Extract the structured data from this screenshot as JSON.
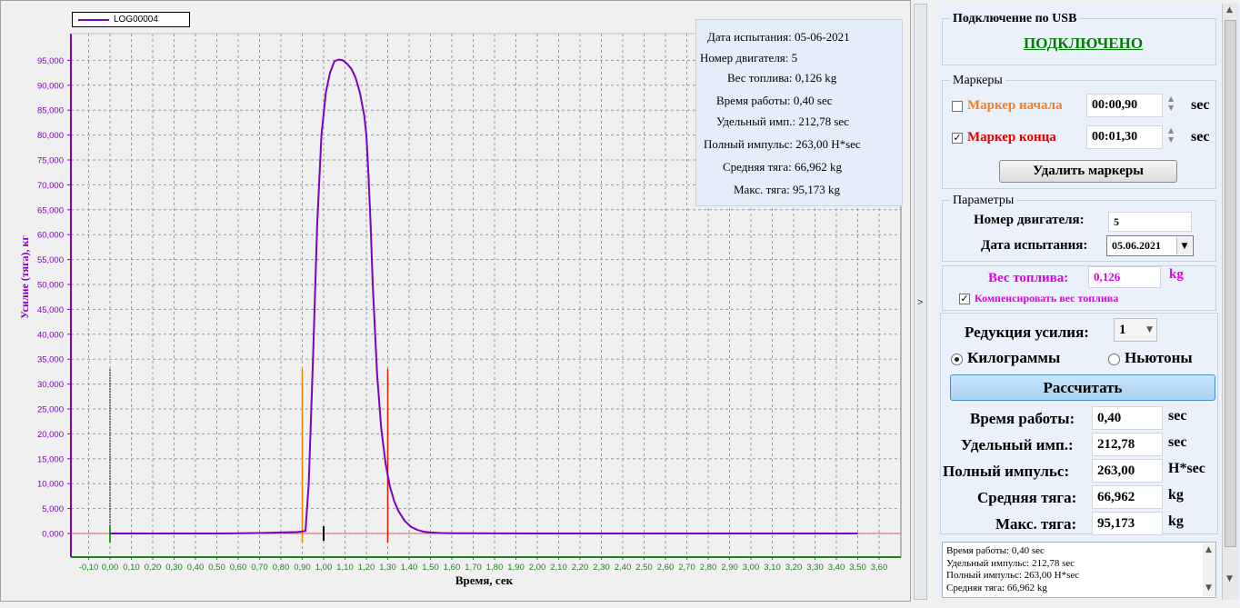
{
  "chart": {
    "legend_label": "LOG00004",
    "ylabel": "Усилие (тяга), кг",
    "xlabel": "Время, сек",
    "info": {
      "test_date": "Дата испытания: 05-06-2021",
      "engine_number": "Номер двигателя: 5",
      "fuel_weight": "Вес топлива: 0,126 kg",
      "burn_time": "Время работы: 0,40 sec",
      "specific_impulse": "Удельный имп.: 212,78 sec",
      "total_impulse": "Полный импульс: 263,00 H*sec",
      "average_thrust": "Средняя тяга: 66,962 kg",
      "max_thrust": "Макс. тяга: 95,173 kg"
    }
  },
  "chart_data": {
    "type": "line",
    "xlabel": "Время, сек",
    "ylabel": "Усилие (тяга), кг",
    "xlim": [
      -0.1,
      3.6
    ],
    "ylim": [
      0,
      100
    ],
    "xticks": [
      "-0,10",
      "0,00",
      "0,10",
      "0,20",
      "0,30",
      "0,40",
      "0,50",
      "0,60",
      "0,70",
      "0,80",
      "0,90",
      "1,00",
      "1,10",
      "1,20",
      "1,30",
      "1,40",
      "1,50",
      "1,60",
      "1,70",
      "1,80",
      "1,90",
      "2,00",
      "2,10",
      "2,20",
      "2,30",
      "2,40",
      "2,50",
      "2,60",
      "2,70",
      "2,80",
      "2,90",
      "3,00",
      "3,10",
      "3,20",
      "3,30",
      "3,40",
      "3,50",
      "3,60"
    ],
    "yticks": [
      "0,000",
      "5,000",
      "10,000",
      "15,000",
      "20,000",
      "25,000",
      "30,000",
      "35,000",
      "40,000",
      "45,000",
      "50,000",
      "55,000",
      "60,000",
      "65,000",
      "70,000",
      "75,000",
      "80,000",
      "85,000",
      "90,000",
      "95,000"
    ],
    "grid": true,
    "legend": "top-left",
    "series": [
      {
        "name": "LOG00004",
        "color": "#8000c0",
        "x": [
          0.0,
          0.5,
          0.7,
          0.8,
          0.88,
          0.915,
          0.93,
          0.95,
          0.97,
          0.99,
          1.01,
          1.03,
          1.05,
          1.07,
          1.09,
          1.11,
          1.13,
          1.15,
          1.17,
          1.19,
          1.2,
          1.21,
          1.22,
          1.23,
          1.25,
          1.27,
          1.29,
          1.31,
          1.33,
          1.35,
          1.38,
          1.41,
          1.44,
          1.47,
          1.5,
          1.55,
          1.6,
          2.0,
          3.0,
          3.5
        ],
        "y": [
          0.0,
          0.0,
          0.1,
          0.2,
          0.3,
          0.5,
          10,
          35,
          62,
          80,
          88.5,
          92.5,
          94.8,
          95.17,
          95.0,
          94.3,
          93.3,
          91.5,
          88.5,
          84,
          80,
          72,
          62,
          50,
          32,
          21,
          14,
          9.5,
          6.5,
          4.5,
          2.5,
          1.3,
          0.7,
          0.35,
          0.2,
          0.1,
          0.05,
          0.0,
          0.0,
          0.0
        ]
      }
    ],
    "markers": [
      {
        "name": "Маркер начала",
        "x": 0.9,
        "color": "#f08000"
      },
      {
        "name": "Маркер конца",
        "x": 1.3,
        "color": "#d02000"
      }
    ],
    "zero_marker_x": 0.0,
    "cursor_x": 1.0
  },
  "splitter": {
    "label": ">"
  },
  "usb": {
    "title": "Подключение по USB",
    "status": "ПОДКЛЮЧЕНО",
    "status_color": "#008000"
  },
  "markers": {
    "title": "Маркеры",
    "start_label": "Маркер начала",
    "start_checked": false,
    "start_value": "00:00,90",
    "start_unit": "sec",
    "start_color": "#f08020",
    "end_label": "Маркер конца",
    "end_checked": true,
    "end_value": "00:01,30",
    "end_unit": "sec",
    "end_color": "#e00000",
    "delete_button": "Удалить маркеры"
  },
  "params": {
    "title": "Параметры",
    "engine_label": "Номер двигателя:",
    "engine_value": "5",
    "date_label": "Дата испытания:",
    "date_value": "05.06.2021",
    "fuel_label": "Вес топлива:",
    "fuel_value": "0,126",
    "fuel_unit": "kg",
    "fuel_color": "#e000e0",
    "compensate_label": "Компенсировать вес топлива",
    "compensate_checked": true
  },
  "calc": {
    "reduction_label": "Редукция усилия:",
    "reduction_value": "1",
    "kg_label": "Килограммы",
    "newton_label": "Ньютоны",
    "selected_unit": "kg",
    "calc_button": "Рассчитать",
    "burn_label": "Время работы:",
    "burn_value": "0,40",
    "burn_unit": "sec",
    "isp_label": "Удельный имп.:",
    "isp_value": "212,78",
    "isp_unit": "sec",
    "total_label": "Полный импульс:",
    "total_value": "263,00",
    "total_unit": "H*sec",
    "avg_label": "Средняя тяга:",
    "avg_value": "66,962",
    "avg_unit": "kg",
    "max_label": "Макс. тяга:",
    "max_value": "95,173",
    "max_unit": "kg"
  },
  "results_text": {
    "line1": "Время работы: 0,40 sec",
    "line2": "Удельный импульс: 212,78 sec",
    "line3": "Полный импульс: 263,00 H*sec",
    "line4": "Средняя тяга: 66,962 kg"
  }
}
